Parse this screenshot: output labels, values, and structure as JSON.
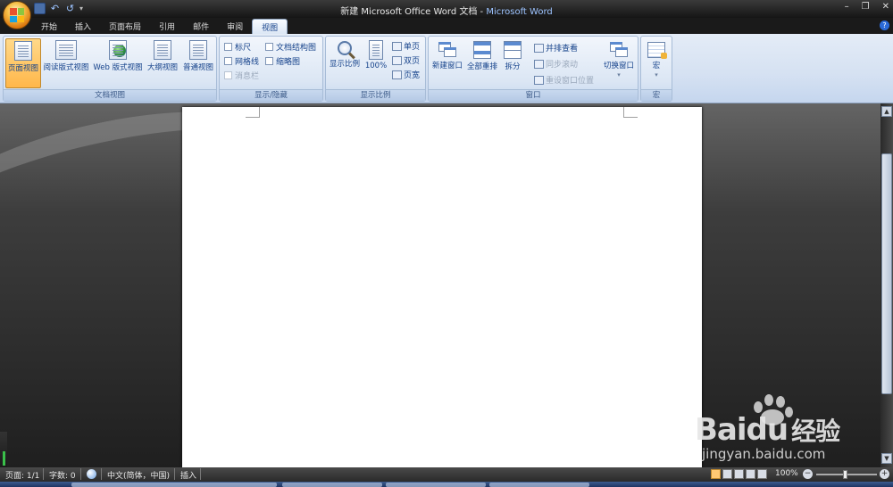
{
  "window": {
    "doc_title": "新建 Microsoft Office Word 文档",
    "separator": " - ",
    "app_name": "Microsoft Word",
    "controls": {
      "minimize": "–",
      "restore": "❐",
      "close": "✕"
    }
  },
  "qat": {
    "save_icon": "save-icon",
    "undo_icon": "↶",
    "redo_icon": "↺",
    "more_icon": "▾"
  },
  "tabs": [
    {
      "label": "开始"
    },
    {
      "label": "插入"
    },
    {
      "label": "页面布局"
    },
    {
      "label": "引用"
    },
    {
      "label": "邮件"
    },
    {
      "label": "审阅"
    },
    {
      "label": "视图",
      "active": true
    }
  ],
  "help": "?",
  "ribbon": {
    "views": {
      "label": "文档视图",
      "buttons": [
        {
          "label": "页面视图",
          "active": true
        },
        {
          "label": "阅读版式视图"
        },
        {
          "label": "Web 版式视图"
        },
        {
          "label": "大纲视图"
        },
        {
          "label": "普通视图"
        }
      ]
    },
    "showhide": {
      "label": "显示/隐藏",
      "ruler": "标尺",
      "gridlines": "网格线",
      "message_bar": "消息栏",
      "doc_map": "文档结构图",
      "thumbnails": "缩略图"
    },
    "zoom": {
      "label": "显示比例",
      "zoom_btn": "显示比例",
      "hundred": "100%",
      "one_page": "单页",
      "two_pages": "双页",
      "page_width": "页宽"
    },
    "window": {
      "label": "窗口",
      "new_window": "新建窗口",
      "arrange_all": "全部重排",
      "split": "拆分",
      "side_by_side": "并排查看",
      "sync_scroll": "同步滚动",
      "reset_position": "重设窗口位置",
      "switch_windows": "切换窗口",
      "arrow": "▾"
    },
    "macros": {
      "label": "宏",
      "button": "宏",
      "arrow": "▾"
    }
  },
  "scroll": {
    "up": "▲",
    "down": "▼"
  },
  "watermark": {
    "brand": "Bai",
    "brand2": "du",
    "brand_zh": "经验",
    "site": "jingyan.baidu.com"
  },
  "status": {
    "page": "页面: 1/1",
    "words": "字数: 0",
    "language": "中文(简体，中国)",
    "mode": "插入",
    "zoom": "100%",
    "zoom_minus": "−",
    "zoom_plus": "+"
  }
}
